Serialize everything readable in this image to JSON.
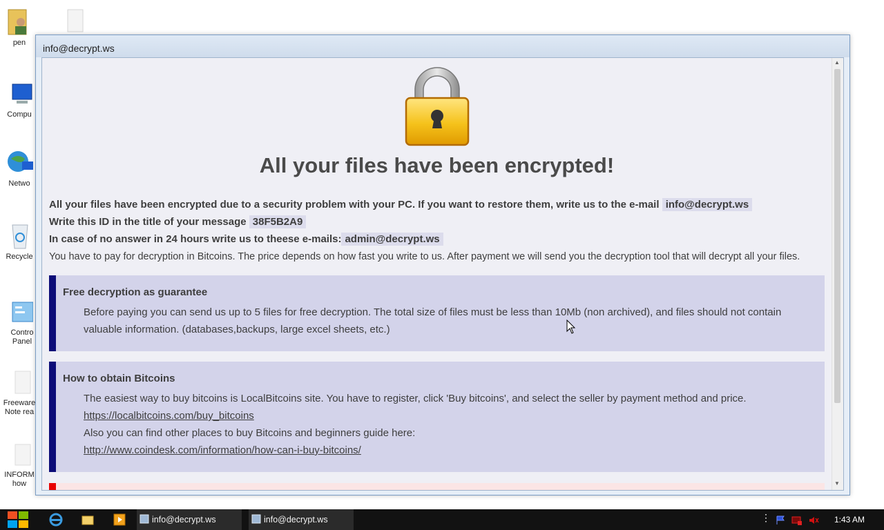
{
  "desktop": {
    "icons": [
      {
        "label": "pen",
        "icon": "user-folder-icon"
      },
      {
        "label": "Compu",
        "icon": "computer-icon"
      },
      {
        "label": "Netwo",
        "icon": "network-icon"
      },
      {
        "label": "Recycle",
        "icon": "recycle-bin-icon"
      },
      {
        "label": "Contro Panel",
        "icon": "control-panel-icon"
      },
      {
        "label": "Freeware Note rea",
        "icon": "document-icon"
      },
      {
        "label": "INFORM how",
        "icon": "document-icon"
      }
    ]
  },
  "window": {
    "title": "info@decrypt.ws"
  },
  "note": {
    "heading": "All your files have been encrypted!",
    "line1_text": "All your files have been encrypted due to a security problem with your PC. If you want to restore them, write us to the e-mail",
    "line1_email": "info@decrypt.ws",
    "line2_text": "Write this ID in the title of your message",
    "line2_id": "38F5B2A9",
    "line3_text": "In case of no answer in 24 hours write us to theese e-mails:",
    "line3_email": "admin@decrypt.ws",
    "line4_text": "You have to pay for decryption in Bitcoins. The price depends on how fast you write to us. After payment we will send you the decryption tool that will decrypt all your files."
  },
  "guarantee": {
    "title": "Free decryption as guarantee",
    "text": "Before paying you can send us up to 5 files for free decryption. The total size of files must be less than 10Mb (non archived), and files should not contain valuable information. (databases,backups, large excel sheets, etc.)"
  },
  "bitcoins": {
    "title": "How to obtain Bitcoins",
    "text1": "The easiest way to buy bitcoins is LocalBitcoins site. You have to register, click 'Buy bitcoins', and select the seller by payment method and price.",
    "link1": "https://localbitcoins.com/buy_bitcoins",
    "text2": "Also you can find other places to buy Bitcoins and beginners guide here:",
    "link2": "http://www.coindesk.com/information/how-can-i-buy-bitcoins/"
  },
  "taskbar": {
    "tasks": [
      "info@decrypt.ws",
      "info@decrypt.ws"
    ],
    "clock": "1:43 AM"
  },
  "colors": {
    "box_accent": "#0c0c78",
    "box_bg": "#d3d3ea",
    "warning_accent": "#e80000",
    "lock_gold": "#f5c21b"
  }
}
